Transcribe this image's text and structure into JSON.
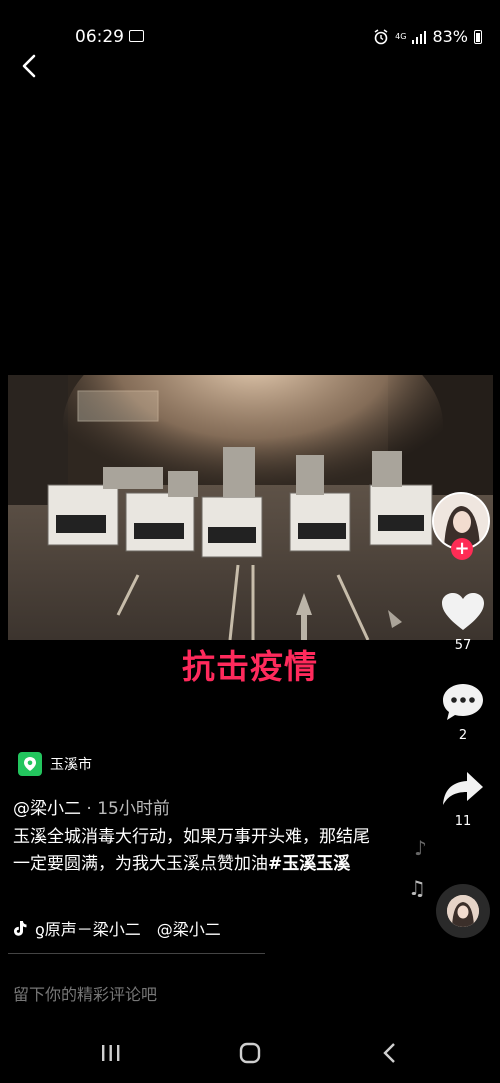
{
  "status_bar": {
    "time": "06:29",
    "network": "4G",
    "battery": "83%"
  },
  "video": {
    "caption": "抗击疫情"
  },
  "actions": {
    "likes": "57",
    "comments": "2",
    "shares": "11"
  },
  "post": {
    "location": "玉溪市",
    "author": "@梁小二",
    "time_ago": " · 15小时前",
    "description": "玉溪全城消毒大行动，如果万事开头难，那结尾一定要圆满，为我大玉溪点赞加油",
    "hashtag": "#玉溪玉溪",
    "music": "ƍ原声－梁小二　@梁小二"
  },
  "comment": {
    "placeholder": "留下你的精彩评论吧"
  },
  "colors": {
    "accent": "#fe2c55",
    "caption": "#ff2a5c",
    "location_pin": "#23c55e"
  }
}
